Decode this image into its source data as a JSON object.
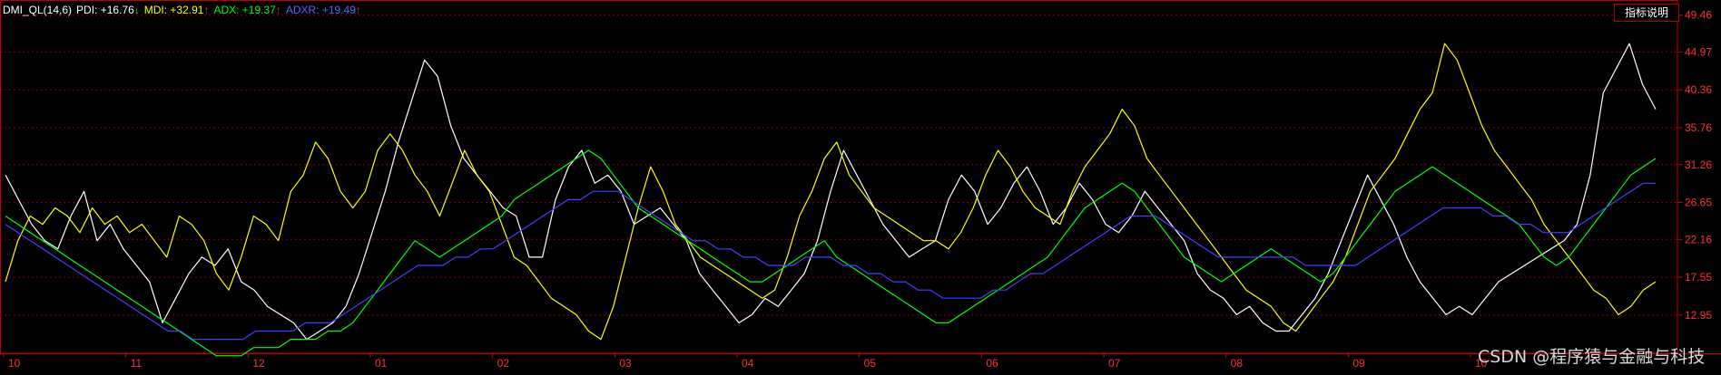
{
  "legend": {
    "name": "DMI_QL(14,6)",
    "pdi": "PDI: +16.76",
    "pdi_arrow": "↓",
    "mdi": "MDI: +32.91",
    "mdi_arrow": "↑",
    "adx": "ADX: +19.37",
    "adx_arrow": "↑",
    "adxr": "ADXR: +19.49",
    "adxr_arrow": "↑"
  },
  "help_button": "指标说明",
  "watermark": "CSDN @程序猿与金融与科技",
  "colors": {
    "background": "#000000",
    "axis": "#c00000",
    "grid": "#8b0000",
    "tick_text": "#ff3030",
    "pdi": "#ffffff",
    "mdi": "#ffff00",
    "adx": "#00ff00",
    "adxr": "#4040ff",
    "down_arrow": "#00ff00",
    "up_arrow": "#ff3030"
  },
  "chart_data": {
    "type": "line",
    "yticks": [
      "49.46",
      "44.97",
      "40.36",
      "35.76",
      "31.26",
      "26.65",
      "22.16",
      "17.55",
      "12.95"
    ],
    "ylim": [
      8.3,
      51.3
    ],
    "xticks": [
      "10",
      "11",
      "12",
      "01",
      "02",
      "03",
      "04",
      "05",
      "06",
      "07",
      "08",
      "09",
      "10"
    ],
    "grid": "horizontal-dotted",
    "series": [
      {
        "name": "PDI",
        "color": "#ffffff",
        "values": [
          30,
          27,
          24,
          22,
          21,
          25,
          28,
          22,
          24,
          21,
          19,
          17,
          12,
          15,
          18,
          20,
          19,
          21,
          17,
          16,
          14,
          13,
          12,
          10,
          11,
          12,
          14,
          18,
          23,
          28,
          34,
          39,
          44,
          42,
          36,
          32,
          30,
          28,
          26,
          25,
          20,
          20,
          27,
          31,
          33,
          29,
          30,
          28,
          24,
          25,
          26,
          24,
          22,
          18,
          16,
          14,
          12,
          13,
          15,
          14,
          16,
          18,
          22,
          28,
          33,
          30,
          27,
          24,
          22,
          20,
          21,
          22,
          27,
          30,
          28,
          24,
          26,
          29,
          31,
          28,
          24,
          26,
          29,
          27,
          24,
          23,
          25,
          28,
          26,
          24,
          22,
          18,
          16,
          15,
          13,
          14,
          12,
          11,
          11,
          13,
          15,
          18,
          22,
          26,
          30,
          27,
          24,
          20,
          17,
          15,
          13,
          14,
          13,
          15,
          17,
          18,
          19,
          20,
          21,
          22,
          24,
          30,
          40,
          43,
          46,
          41,
          38
        ]
      },
      {
        "name": "MDI",
        "color": "#ffff00",
        "values": [
          17,
          22,
          25,
          24,
          26,
          25,
          23,
          26,
          24,
          25,
          23,
          24,
          22,
          20,
          25,
          24,
          22,
          18,
          16,
          20,
          25,
          24,
          22,
          28,
          30,
          34,
          32,
          28,
          26,
          28,
          33,
          35,
          33,
          30,
          28,
          25,
          29,
          33,
          30,
          28,
          24,
          20,
          19,
          17,
          15,
          14,
          13,
          11,
          10,
          14,
          20,
          26,
          31,
          28,
          24,
          22,
          20,
          19,
          18,
          17,
          16,
          15,
          16,
          20,
          25,
          28,
          32,
          34,
          30,
          28,
          26,
          25,
          24,
          23,
          22,
          22,
          21,
          23,
          26,
          30,
          33,
          31,
          28,
          26,
          25,
          24,
          28,
          31,
          33,
          35,
          38,
          36,
          32,
          30,
          28,
          26,
          24,
          22,
          20,
          18,
          16,
          15,
          14,
          12,
          11,
          13,
          15,
          17,
          20,
          24,
          28,
          30,
          32,
          35,
          38,
          40,
          46,
          44,
          40,
          36,
          33,
          31,
          29,
          27,
          24,
          22,
          20,
          18,
          16,
          15,
          13,
          14,
          16,
          17
        ]
      },
      {
        "name": "ADX",
        "color": "#00ff00",
        "values": [
          25,
          24,
          23,
          22,
          21,
          20,
          19,
          18,
          17,
          16,
          15,
          14,
          13,
          12,
          11,
          10,
          9,
          8,
          8,
          8,
          9,
          9,
          9,
          10,
          10,
          10,
          11,
          11,
          12,
          14,
          16,
          18,
          20,
          22,
          21,
          20,
          21,
          22,
          23,
          24,
          25,
          27,
          28,
          29,
          30,
          31,
          32,
          33,
          32,
          30,
          28,
          26,
          25,
          24,
          23,
          22,
          21,
          20,
          19,
          18,
          17,
          17,
          18,
          19,
          20,
          21,
          22,
          20,
          19,
          18,
          17,
          16,
          15,
          14,
          13,
          12,
          12,
          13,
          14,
          15,
          16,
          17,
          18,
          19,
          20,
          22,
          24,
          26,
          27,
          28,
          29,
          28,
          26,
          24,
          22,
          20,
          19,
          18,
          17,
          18,
          19,
          20,
          21,
          20,
          19,
          18,
          17,
          18,
          20,
          22,
          24,
          26,
          28,
          29,
          30,
          31,
          30,
          29,
          28,
          27,
          26,
          25,
          24,
          22,
          20,
          19,
          20,
          22,
          24,
          26,
          28,
          30,
          31,
          32
        ]
      },
      {
        "name": "ADXR",
        "color": "#4040ff",
        "values": [
          24,
          23,
          22,
          21,
          20,
          19,
          18,
          17,
          16,
          15,
          14,
          13,
          12,
          11,
          11,
          10,
          10,
          10,
          10,
          10,
          11,
          11,
          11,
          11,
          12,
          12,
          12,
          13,
          14,
          15,
          16,
          17,
          18,
          19,
          19,
          19,
          20,
          20,
          21,
          21,
          22,
          23,
          24,
          25,
          26,
          27,
          27,
          28,
          28,
          28,
          27,
          26,
          25,
          24,
          23,
          22,
          22,
          21,
          21,
          20,
          20,
          19,
          19,
          19,
          20,
          20,
          20,
          19,
          19,
          18,
          18,
          17,
          17,
          16,
          16,
          15,
          15,
          15,
          15,
          16,
          16,
          17,
          18,
          18,
          19,
          20,
          21,
          22,
          23,
          24,
          25,
          25,
          25,
          24,
          23,
          22,
          21,
          20,
          20,
          20,
          20,
          20,
          20,
          20,
          19,
          19,
          19,
          19,
          19,
          20,
          21,
          22,
          23,
          24,
          25,
          26,
          26,
          26,
          26,
          25,
          25,
          24,
          24,
          23,
          23,
          23,
          24,
          25,
          26,
          27,
          28,
          29,
          29
        ]
      }
    ]
  }
}
